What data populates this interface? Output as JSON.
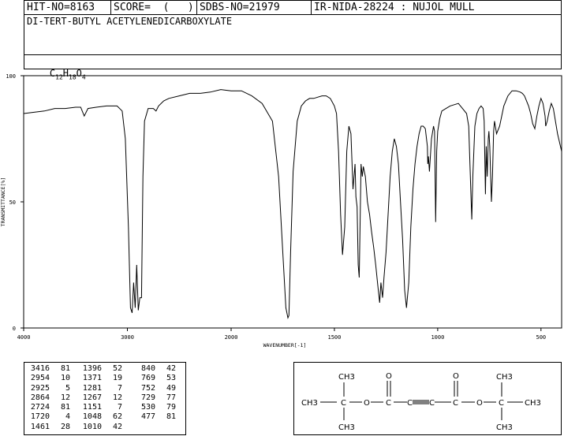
{
  "header": {
    "hit_no": "HIT-NO=8163",
    "score": "SCORE=  (   )",
    "sdbs_no": "SDBS-NO=21979",
    "ir_info": "IR-NIDA-28224 : NUJOL MULL",
    "compound_name": "DI-TERT-BUTYL ACETYLENEDICARBOXYLATE",
    "formula_parts": [
      {
        "text": "C",
        "sub": false
      },
      {
        "text": "12",
        "sub": true
      },
      {
        "text": "H",
        "sub": false
      },
      {
        "text": "18",
        "sub": true
      },
      {
        "text": "O",
        "sub": false
      },
      {
        "text": "4",
        "sub": true
      }
    ]
  },
  "chart_data": {
    "type": "line",
    "title": "",
    "xlabel": "WAVENUMBER[-1]",
    "ylabel": "TRANSMITTANCE[%]",
    "xlim": [
      4000,
      400
    ],
    "ylim": [
      0,
      100
    ],
    "x_ticks": [
      4000,
      3000,
      2000,
      1500,
      1000,
      500
    ],
    "y_ticks": [
      0,
      50,
      100
    ],
    "series": [
      {
        "name": "",
        "x": [
          4000,
          3900,
          3800,
          3700,
          3600,
          3500,
          3450,
          3416,
          3380,
          3300,
          3200,
          3100,
          3050,
          3020,
          2990,
          2970,
          2954,
          2940,
          2925,
          2910,
          2895,
          2880,
          2864,
          2850,
          2835,
          2800,
          2750,
          2724,
          2700,
          2650,
          2600,
          2500,
          2400,
          2300,
          2200,
          2100,
          2000,
          1950,
          1900,
          1850,
          1800,
          1770,
          1750,
          1735,
          1725,
          1720,
          1712,
          1700,
          1680,
          1660,
          1640,
          1620,
          1600,
          1580,
          1560,
          1540,
          1520,
          1500,
          1490,
          1480,
          1470,
          1461,
          1450,
          1440,
          1430,
          1420,
          1410,
          1400,
          1396,
          1390,
          1385,
          1380,
          1375,
          1371,
          1365,
          1360,
          1350,
          1340,
          1330,
          1320,
          1310,
          1300,
          1290,
          1281,
          1275,
          1267,
          1260,
          1250,
          1240,
          1230,
          1220,
          1210,
          1200,
          1190,
          1180,
          1170,
          1160,
          1151,
          1140,
          1130,
          1120,
          1110,
          1100,
          1090,
          1080,
          1070,
          1060,
          1050,
          1048,
          1045,
          1040,
          1030,
          1020,
          1015,
          1010,
          1005,
          1000,
          990,
          980,
          960,
          940,
          920,
          900,
          880,
          860,
          850,
          840,
          835,
          830,
          820,
          810,
          800,
          790,
          780,
          775,
          769,
          765,
          760,
          755,
          752,
          748,
          740,
          735,
          729,
          725,
          715,
          700,
          680,
          660,
          640,
          620,
          600,
          590,
          580,
          570,
          560,
          550,
          540,
          530,
          520,
          510,
          500,
          490,
          480,
          477,
          470,
          460,
          450,
          440,
          420,
          400
        ],
        "y": [
          85,
          85.5,
          86,
          87,
          87,
          87.5,
          87.5,
          84,
          87,
          87.5,
          88,
          88,
          86,
          75,
          40,
          8,
          6,
          18,
          8,
          25,
          7,
          12,
          12,
          60,
          82,
          87,
          87,
          86,
          88,
          90,
          91,
          92,
          93,
          93,
          93.5,
          94.5,
          94,
          94,
          92,
          89,
          82,
          60,
          30,
          8,
          4,
          5,
          30,
          62,
          82,
          88,
          90,
          91,
          91,
          91.5,
          92,
          92,
          91,
          88,
          85,
          70,
          45,
          29,
          40,
          70,
          80,
          77,
          55,
          65,
          52,
          48,
          25,
          20,
          45,
          65,
          60,
          64,
          60,
          50,
          45,
          38,
          32,
          25,
          17,
          10,
          18,
          12,
          20,
          30,
          45,
          60,
          70,
          75,
          72,
          65,
          50,
          35,
          15,
          8,
          18,
          40,
          55,
          65,
          72,
          77,
          80,
          80,
          79,
          72,
          65,
          68,
          62,
          75,
          80,
          78,
          42,
          70,
          78,
          83,
          86,
          87,
          88,
          88.5,
          89,
          87,
          85,
          80,
          55,
          43,
          60,
          80,
          85,
          87,
          88,
          87,
          82,
          53,
          72,
          60,
          75,
          78,
          72,
          50,
          60,
          78,
          82,
          77,
          80,
          88,
          92,
          94,
          94,
          93.5,
          93,
          92,
          90,
          88,
          85,
          81,
          79,
          84,
          88,
          91,
          89,
          84,
          80,
          82,
          86,
          89,
          87,
          77,
          70
        ]
      }
    ],
    "grid": false,
    "legend": "none"
  },
  "peak_table": {
    "columns": [
      [
        [
          "3416",
          "81"
        ],
        [
          "2954",
          "10"
        ],
        [
          "2925",
          "5"
        ],
        [
          "2864",
          "12"
        ],
        [
          "2724",
          "81"
        ],
        [
          "1720",
          "4"
        ],
        [
          "1461",
          "28"
        ]
      ],
      [
        [
          "1396",
          "52"
        ],
        [
          "1371",
          "19"
        ],
        [
          "1281",
          "7"
        ],
        [
          "1267",
          "12"
        ],
        [
          "1151",
          "7"
        ],
        [
          "1048",
          "62"
        ],
        [
          "1010",
          "42"
        ]
      ],
      [
        [
          "840",
          "42"
        ],
        [
          "769",
          "53"
        ],
        [
          "752",
          "49"
        ],
        [
          "729",
          "77"
        ],
        [
          "530",
          "79"
        ],
        [
          "477",
          "81"
        ]
      ]
    ]
  },
  "structure": {
    "labels": {
      "ch3_top_left": "CH3",
      "ch3_left": "CH3",
      "ch3_bottom_left": "CH3",
      "o_carbonyl_left": "O",
      "o_ester_left": "O",
      "c_quat_left": "C",
      "c_carbonyl_left": "C",
      "c_alkyne_left": "C",
      "c_alkyne_right": "C",
      "c_carbonyl_right": "C",
      "o_carbonyl_right": "O",
      "o_ester_right": "O",
      "c_quat_right": "C",
      "ch3_top_right": "CH3",
      "ch3_right": "CH3",
      "ch3_bottom_right": "CH3"
    }
  }
}
